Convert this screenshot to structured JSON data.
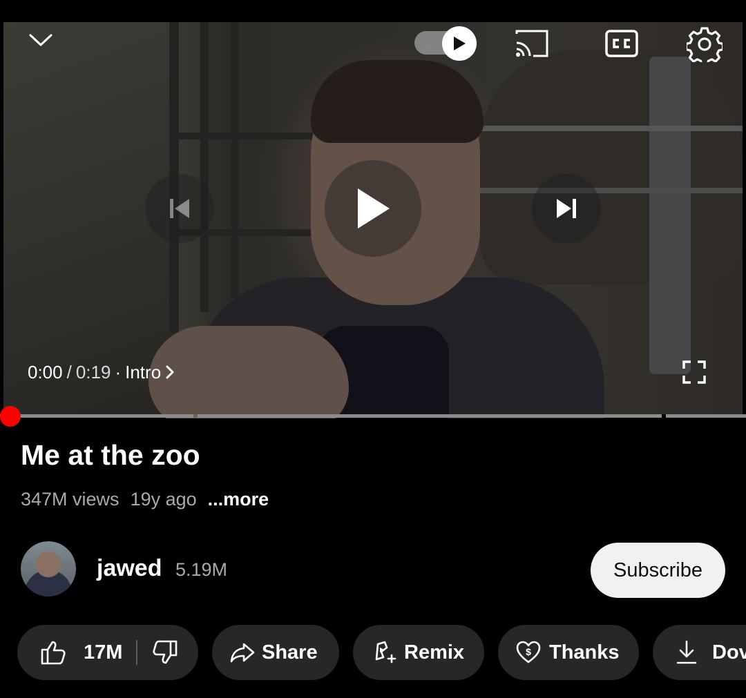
{
  "player": {
    "current_time": "0:00",
    "separator": "/",
    "duration": "0:19",
    "dot": "·",
    "chapter": "Intro",
    "progress_fraction": 0.0
  },
  "icons": {
    "collapse": "chevron-down-icon",
    "autoplay": "autoplay-toggle-icon",
    "cast": "cast-icon",
    "captions": "closed-captions-icon",
    "settings": "gear-icon",
    "previous": "skip-previous-icon",
    "play": "play-icon",
    "next": "skip-next-icon",
    "fullscreen": "fullscreen-icon",
    "like": "thumbs-up-icon",
    "dislike": "thumbs-down-icon",
    "share": "share-arrow-icon",
    "remix": "remix-icon",
    "thanks": "heart-dollar-icon",
    "download": "download-icon"
  },
  "video": {
    "title": "Me at the zoo",
    "views": "347M views",
    "age": "19y ago",
    "more_label": "...more"
  },
  "channel": {
    "name": "jawed",
    "subscribers": "5.19M",
    "subscribe_label": "Subscribe"
  },
  "actions": {
    "likes": "17M",
    "share_label": "Share",
    "remix_label": "Remix",
    "thanks_label": "Thanks",
    "download_label": "Dov"
  },
  "colors": {
    "progress_accent": "#ff0000",
    "background": "#000000",
    "pill_background": "#272727",
    "subscribe_background": "#f1f1f1"
  }
}
